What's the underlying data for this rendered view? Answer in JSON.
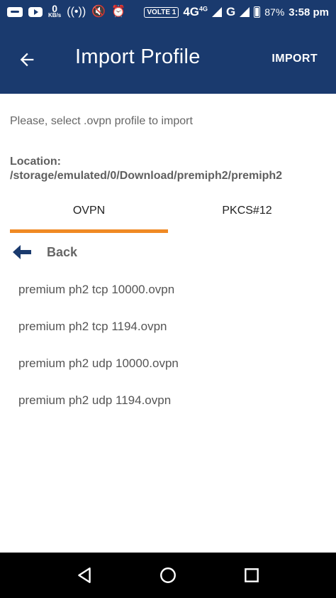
{
  "status_bar": {
    "data_rate_value": "0",
    "data_rate_unit": "KB/s",
    "volte_label": "VOLTE 1",
    "network_label": "4G",
    "network_sup": "4G",
    "network_g": "G",
    "battery": "87%",
    "time": "3:58 pm"
  },
  "appbar": {
    "title": "Import Profile",
    "action": "IMPORT"
  },
  "instruction": "Please, select .ovpn profile to import",
  "location": "Location: /storage/emulated/0/Download/premiph2/premiph2",
  "tabs": [
    {
      "label": "OVPN",
      "active": true
    },
    {
      "label": "PKCS#12",
      "active": false
    }
  ],
  "back_label": "Back",
  "files": [
    "premium ph2 tcp 10000.ovpn",
    "premium ph2 tcp 1194.ovpn",
    "premium ph2 udp 10000.ovpn",
    "premium ph2 udp 1194.ovpn"
  ],
  "colors": {
    "primary": "#1a3a6e",
    "accent": "#f08a24"
  },
  "icons": {
    "appbar_back": "arrow-left-icon",
    "list_back": "arrow-left-bold-icon",
    "nav_back": "triangle-back-icon",
    "nav_home": "circle-home-icon",
    "nav_recents": "square-recents-icon"
  }
}
